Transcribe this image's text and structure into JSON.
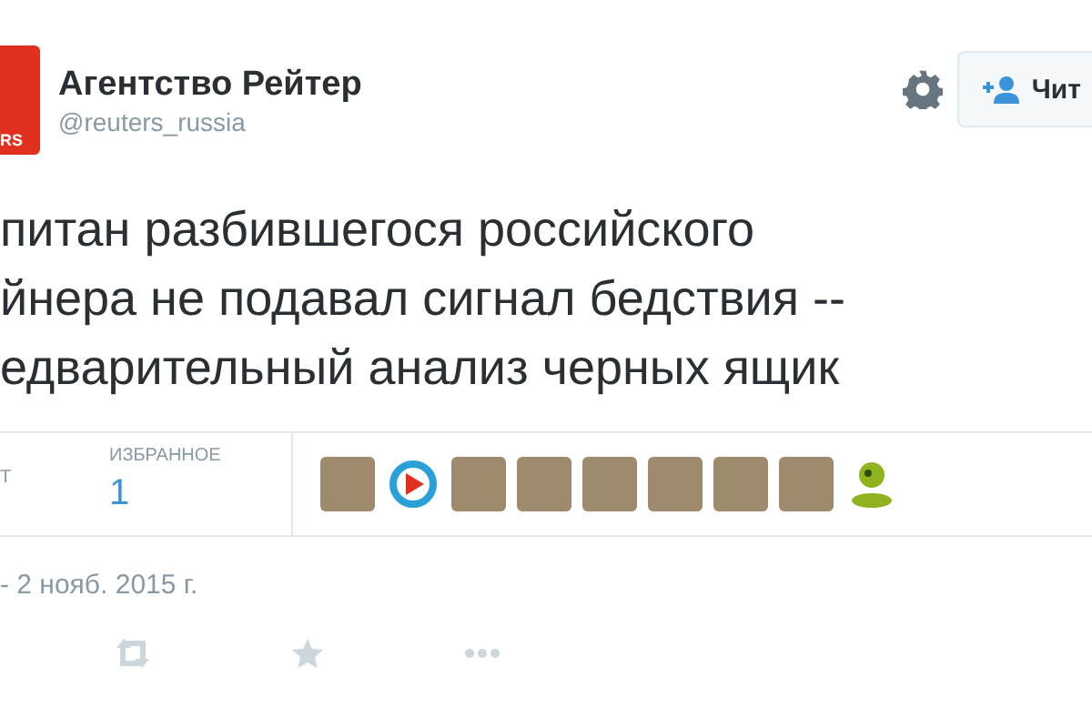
{
  "header": {
    "logo_text": "RS",
    "name": "Агентство Рейтер",
    "handle": "@reuters_russia",
    "follow_button": "Чит"
  },
  "tweet": {
    "lines": [
      "питан разбившегося российского",
      "йнера не подавал сигнал бедствия --",
      "едварительный анализ черных ящик"
    ]
  },
  "stats": [
    {
      "label": "Т"
    },
    {
      "label": "ИЗБРАННОЕ",
      "value": "1"
    }
  ],
  "favorited_by": [
    {
      "kind": "photo"
    },
    {
      "kind": "logo"
    },
    {
      "kind": "photo"
    },
    {
      "kind": "photo"
    },
    {
      "kind": "photo"
    },
    {
      "kind": "photo"
    },
    {
      "kind": "photo"
    },
    {
      "kind": "photo"
    },
    {
      "kind": "mascot"
    }
  ],
  "date": "- 2 нояб. 2015 г."
}
